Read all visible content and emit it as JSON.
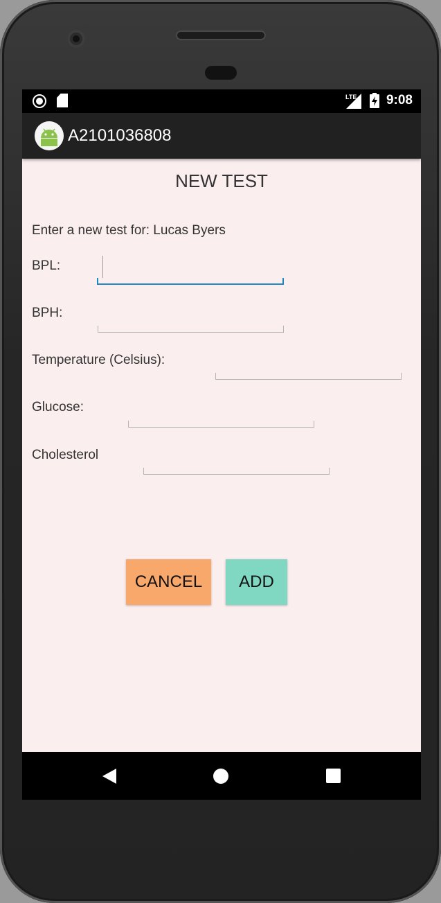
{
  "status_bar": {
    "time": "9:08",
    "network_label": "LTE",
    "icons": [
      "record-icon",
      "sd-card-icon",
      "lte-signal-icon",
      "battery-charging-icon"
    ]
  },
  "app_bar": {
    "title": "A2101036808",
    "logo_icon": "android-icon"
  },
  "form": {
    "page_title": "NEW TEST",
    "intro": "Enter a new test for: Lucas Byers",
    "fields": [
      {
        "label": "BPL:",
        "value": ""
      },
      {
        "label": "BPH:",
        "value": ""
      },
      {
        "label": "Temperature (Celsius):",
        "value": ""
      },
      {
        "label": "Glucose:",
        "value": ""
      },
      {
        "label": "Cholesterol",
        "value": ""
      }
    ]
  },
  "buttons": {
    "cancel": "CANCEL",
    "add": "ADD"
  },
  "colors": {
    "background": "#fbeeee",
    "appbar": "#212121",
    "focus_accent": "#1e88c7",
    "cancel_button": "#f9a86b",
    "add_button": "#80d8c2"
  },
  "nav_bar": {
    "icons": [
      "back-icon",
      "home-icon",
      "recents-icon"
    ]
  }
}
